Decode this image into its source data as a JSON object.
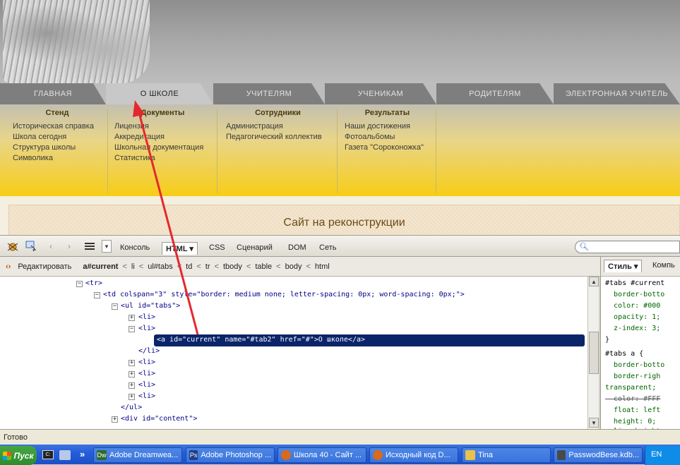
{
  "website": {
    "tabs": [
      "ГЛАВНАЯ",
      "О ШКОЛЕ",
      "УЧИТЕЛЯМ",
      "УЧЕНИКАМ",
      "РОДИТЕЛЯМ",
      "ЭЛЕКТРОННАЯ УЧИТЕЛЬ"
    ],
    "active_tab": "О ШКОЛЕ",
    "columns": [
      {
        "heading": "Стенд",
        "items": [
          "Историческая справка",
          "Школа сегодня",
          "Структура школы",
          "Символика"
        ]
      },
      {
        "heading": "Документы",
        "items": [
          "Лицензия",
          "Аккредитация",
          "Школьная документация",
          "Статистика"
        ]
      },
      {
        "heading": "Сотрудники",
        "items": [
          "Администрация",
          "Педагогический коллектив"
        ]
      },
      {
        "heading": "Результаты",
        "items": [
          "Наши достижения",
          "Фотоальбомы",
          "Газета \"Сороконожка\""
        ]
      }
    ],
    "banner_text": "Сайт на реконструкции"
  },
  "firebug": {
    "tabs": [
      "Консоль",
      "HTML",
      "CSS",
      "Сценарий",
      "DOM",
      "Сеть"
    ],
    "active_tab": "HTML",
    "edit_label": "Редактировать",
    "breadcrumb": [
      "a#current",
      "li",
      "ul#tabs",
      "td",
      "tr",
      "tbody",
      "table",
      "body",
      "html"
    ],
    "html_lines": [
      "<tr>",
      "<td colspan=\"3\" style=\"border: medium none; letter-spacing: 0px; word-spacing: 0px;\">",
      "<ul id=\"tabs\">",
      "<li>",
      "<li>",
      "<a id=\"current\" name=\"#tab2\" href=\"#\">О школе</a>",
      "</li>",
      "<li>",
      "<li>",
      "<li>",
      "<li>",
      "</ul>",
      "<div id=\"content\">"
    ],
    "side_tabs": [
      "Стиль",
      "Компь"
    ],
    "css_lines": [
      "#tabs #current",
      "  border-botto",
      "  color: #000",
      "  opacity: 1;",
      "  z-index: 3;",
      "}",
      "#tabs a {",
      "  border-botto",
      "  border-righ",
      "transparent;",
      "  color: #FFF",
      "  float: left",
      "  height: 0;",
      "  line-height"
    ]
  },
  "status_text": "Готово",
  "taskbar": {
    "start_label": "Пуск",
    "buttons": [
      {
        "label": "Adobe Dreamwea...",
        "icon": "dreamweaver-icon",
        "color": "#2f6b2f"
      },
      {
        "label": "Adobe Photoshop ...",
        "icon": "photoshop-icon",
        "color": "#1f3f8a"
      },
      {
        "label": "Школа 40 - Сайт ...",
        "icon": "firefox-icon",
        "color": "#d86a1a"
      },
      {
        "label": "Исходный код D...",
        "icon": "firefox-icon",
        "color": "#d86a1a"
      },
      {
        "label": "Tina",
        "icon": "folder-icon",
        "color": "#e8c24a"
      },
      {
        "label": "PasswodBese.kdb...",
        "icon": "keepass-icon",
        "color": "#4a4a4a"
      }
    ],
    "language": "EN"
  }
}
